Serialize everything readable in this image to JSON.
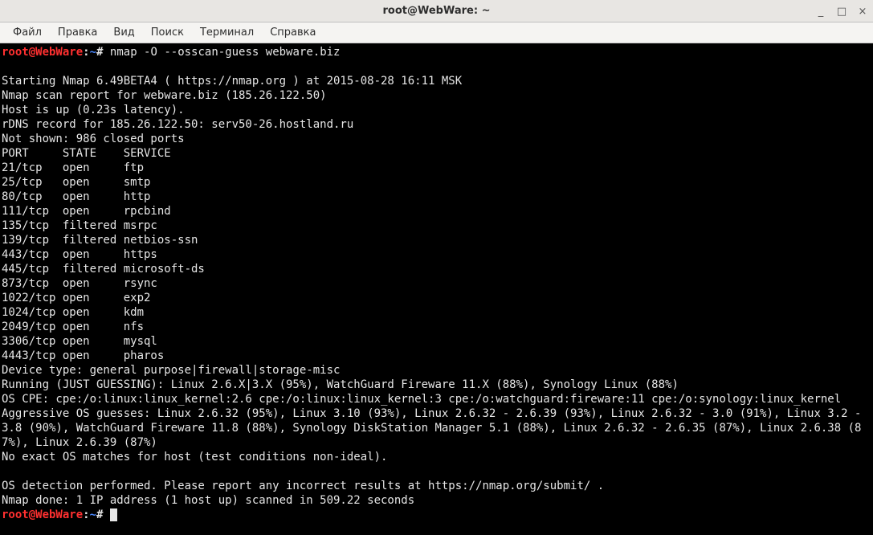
{
  "window": {
    "title": "root@WebWare: ~",
    "controls": {
      "min": "_",
      "max": "□",
      "close": "×"
    }
  },
  "menu": {
    "items": [
      "Файл",
      "Правка",
      "Вид",
      "Поиск",
      "Терминал",
      "Справка"
    ]
  },
  "prompt": {
    "user_host": "root@WebWare",
    "colon": ":",
    "path": "~",
    "hash": "#"
  },
  "command": "nmap -O --osscan-guess webware.biz",
  "output_lines": [
    "",
    "Starting Nmap 6.49BETA4 ( https://nmap.org ) at 2015-08-28 16:11 MSK",
    "Nmap scan report for webware.biz (185.26.122.50)",
    "Host is up (0.23s latency).",
    "rDNS record for 185.26.122.50: serv50-26.hostland.ru",
    "Not shown: 986 closed ports",
    "PORT     STATE    SERVICE",
    "21/tcp   open     ftp",
    "25/tcp   open     smtp",
    "80/tcp   open     http",
    "111/tcp  open     rpcbind",
    "135/tcp  filtered msrpc",
    "139/tcp  filtered netbios-ssn",
    "443/tcp  open     https",
    "445/tcp  filtered microsoft-ds",
    "873/tcp  open     rsync",
    "1022/tcp open     exp2",
    "1024/tcp open     kdm",
    "2049/tcp open     nfs",
    "3306/tcp open     mysql",
    "4443/tcp open     pharos",
    "Device type: general purpose|firewall|storage-misc",
    "Running (JUST GUESSING): Linux 2.6.X|3.X (95%), WatchGuard Fireware 11.X (88%), Synology Linux (88%)",
    "OS CPE: cpe:/o:linux:linux_kernel:2.6 cpe:/o:linux:linux_kernel:3 cpe:/o:watchguard:fireware:11 cpe:/o:synology:linux_kernel",
    "Aggressive OS guesses: Linux 2.6.32 (95%), Linux 3.10 (93%), Linux 2.6.32 - 2.6.39 (93%), Linux 2.6.32 - 3.0 (91%), Linux 3.2 - 3.8 (90%), WatchGuard Fireware 11.8 (88%), Synology DiskStation Manager 5.1 (88%), Linux 2.6.32 - 2.6.35 (87%), Linux 2.6.38 (87%), Linux 2.6.39 (87%)",
    "No exact OS matches for host (test conditions non-ideal).",
    "",
    "OS detection performed. Please report any incorrect results at https://nmap.org/submit/ .",
    "Nmap done: 1 IP address (1 host up) scanned in 509.22 seconds"
  ]
}
